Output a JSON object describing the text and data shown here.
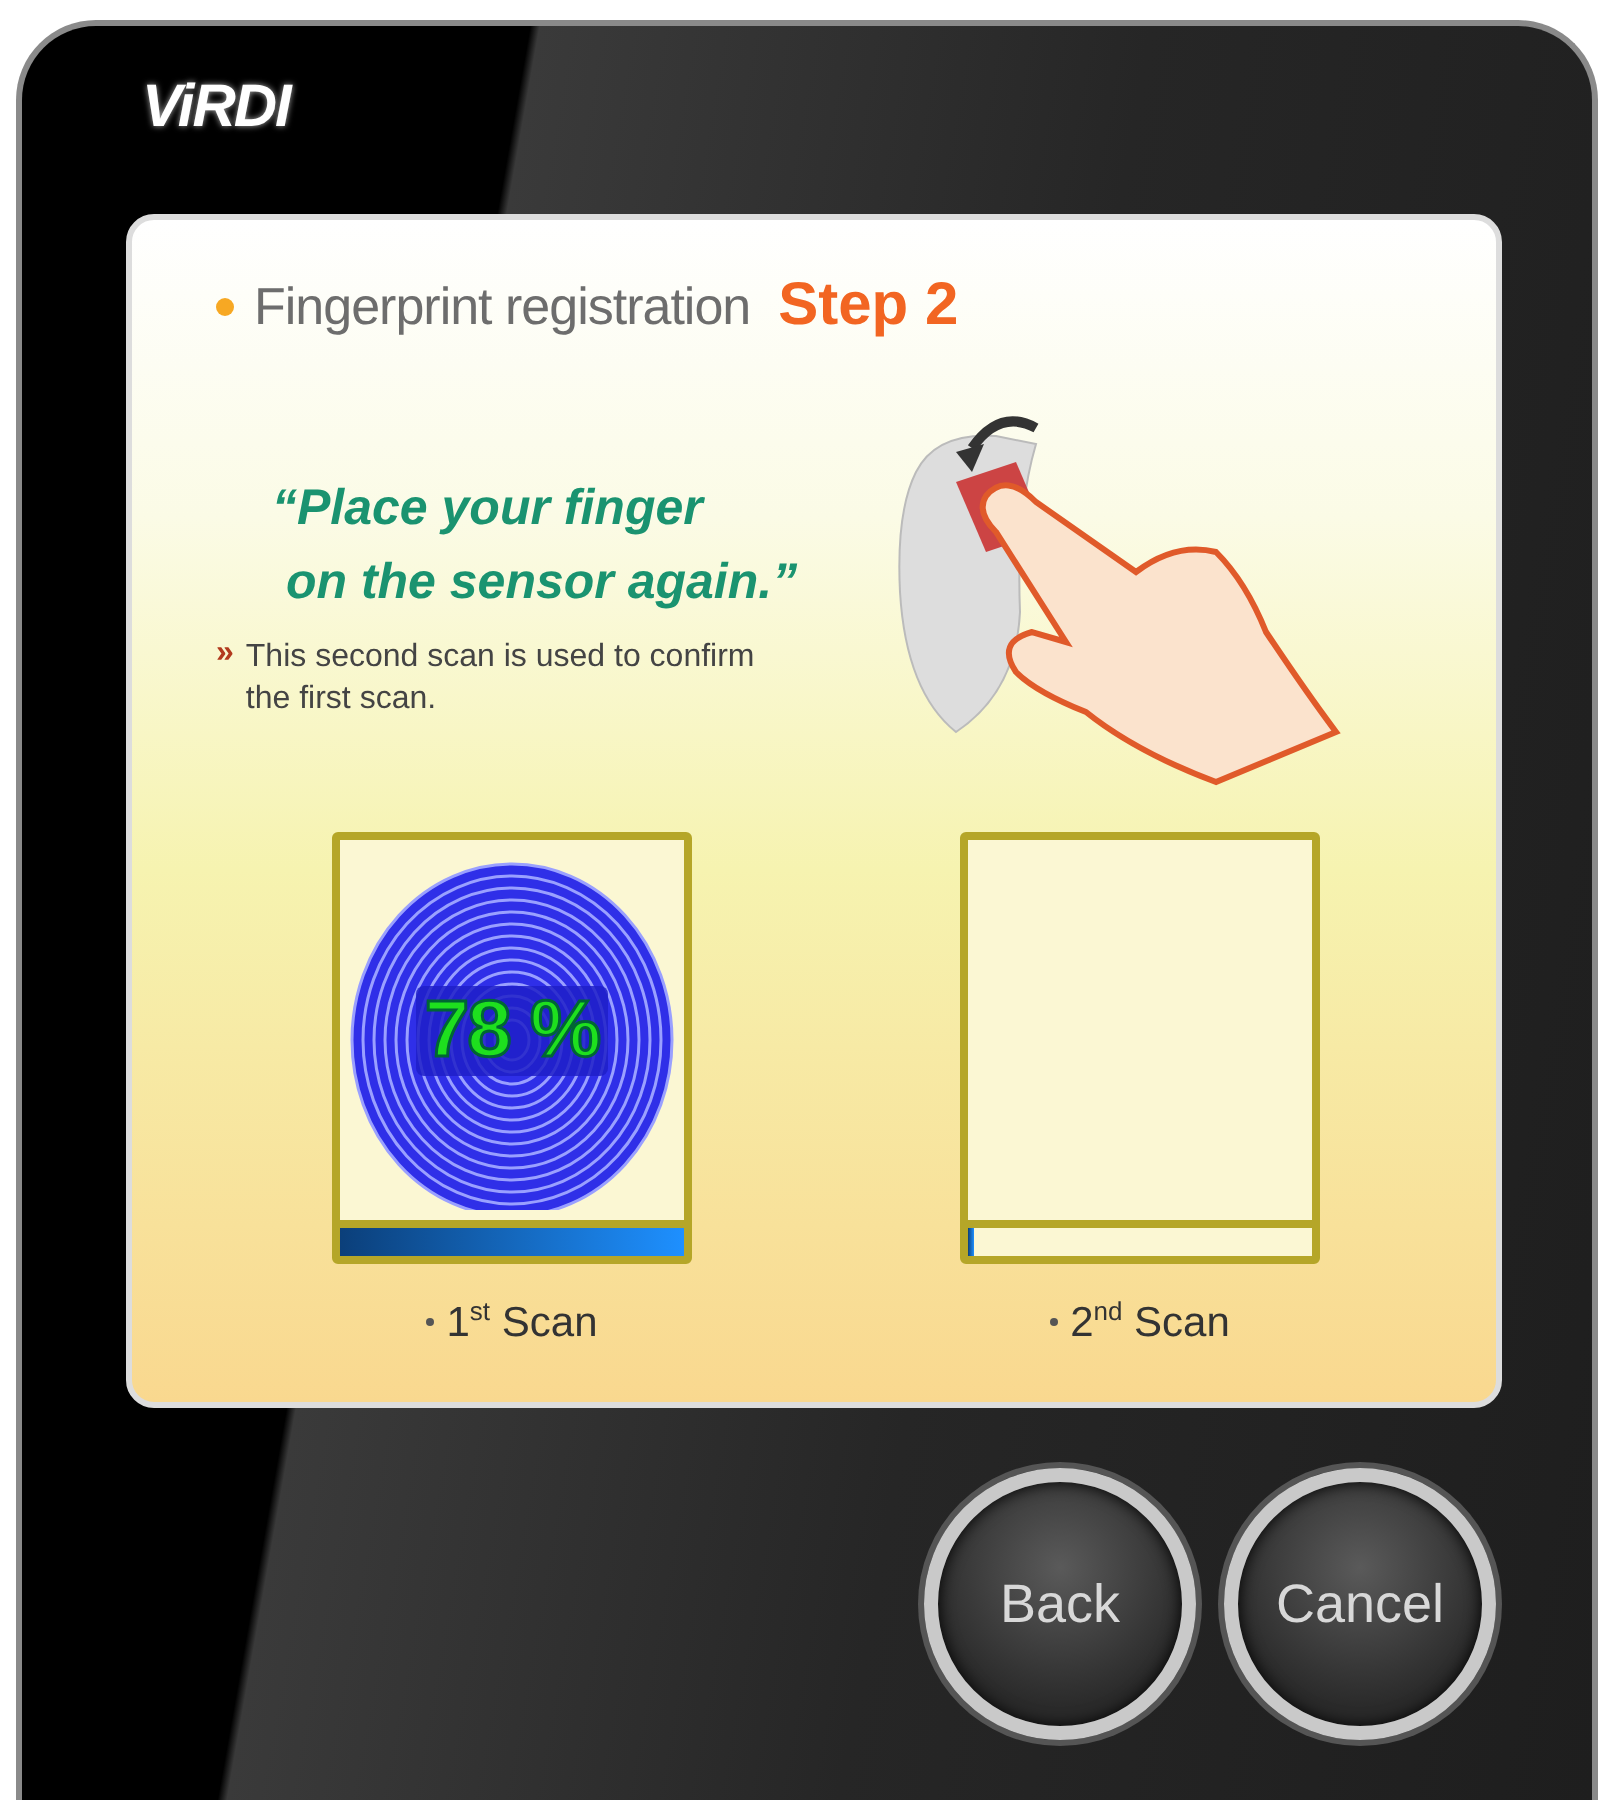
{
  "logo": "ViRDI",
  "heading": {
    "label": "Fingerprint registration",
    "step": "Step 2"
  },
  "instruction": {
    "open_quote": "“",
    "lines": [
      "Place your finger",
      "on the sensor again."
    ],
    "close_quote": "”"
  },
  "note": {
    "marker": "»",
    "text": "This second scan is used to confirm the first scan."
  },
  "scans": [
    {
      "label": "1$^{st}$ Scan",
      "has_image": true,
      "percent": "78 %",
      "level": 1.0
    },
    {
      "label": "2$^{nd}$ Scan",
      "has_image": false,
      "level": 0.01
    }
  ],
  "buttons": [
    "Back",
    "Cancel"
  ]
}
